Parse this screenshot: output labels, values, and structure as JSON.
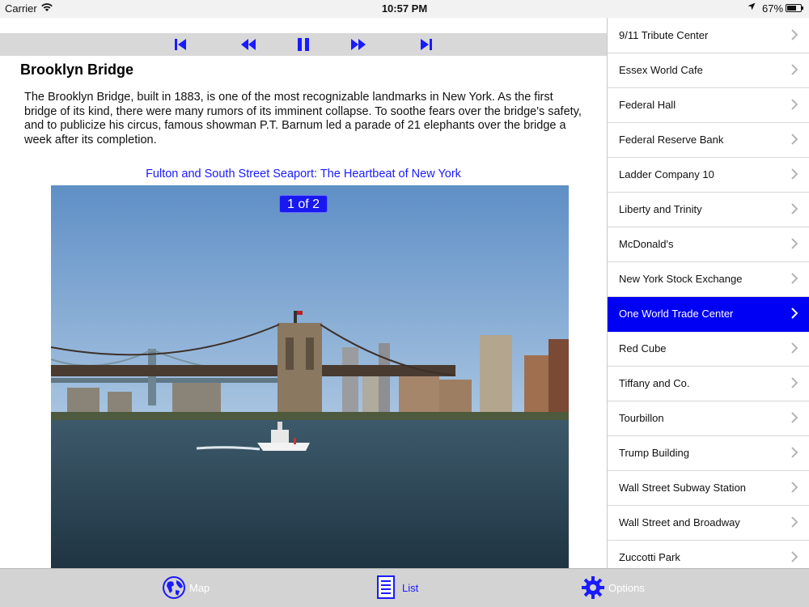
{
  "status_bar": {
    "carrier": "Carrier",
    "time": "10:57 PM",
    "battery_percent": "67%",
    "battery_level": 0.67,
    "icons": [
      "wifi-icon",
      "location-arrow-icon",
      "battery-icon"
    ]
  },
  "media_controls": {
    "icons": [
      "skip-back-icon",
      "rewind-icon",
      "pause-icon",
      "fast-forward-icon",
      "skip-forward-icon"
    ],
    "color": "#1a1aff"
  },
  "detail": {
    "title": "Brooklyn Bridge",
    "description": "The Brooklyn Bridge, built in 1883, is one of the most recognizable landmarks in New York. As the first bridge of its kind, there were many rumors of its imminent collapse. To soothe fears over the bridge's safety, and to publicize his circus, famous showman P.T. Barnum led a parade of 21 elephants over the bridge a week after its completion.",
    "caption": "Fulton and South Street Seaport: The Heartbeat of New York",
    "photo_counter": "1 of 2"
  },
  "sidebar": {
    "items": [
      {
        "label": "9/11 Tribute Center",
        "selected": false
      },
      {
        "label": "Essex World Cafe",
        "selected": false
      },
      {
        "label": "Federal Hall",
        "selected": false
      },
      {
        "label": "Federal Reserve Bank",
        "selected": false
      },
      {
        "label": "Ladder Company 10",
        "selected": false
      },
      {
        "label": "Liberty and Trinity",
        "selected": false
      },
      {
        "label": "McDonald's",
        "selected": false
      },
      {
        "label": "New York Stock Exchange",
        "selected": false
      },
      {
        "label": "One World Trade Center",
        "selected": true
      },
      {
        "label": "Red Cube",
        "selected": false
      },
      {
        "label": "Tiffany and Co.",
        "selected": false
      },
      {
        "label": "Tourbillon",
        "selected": false
      },
      {
        "label": "Trump Building",
        "selected": false
      },
      {
        "label": "Wall Street Subway Station",
        "selected": false
      },
      {
        "label": "Wall Street and Broadway",
        "selected": false
      },
      {
        "label": "Zuccotti Park",
        "selected": false
      }
    ],
    "selected_color": "#0000f5"
  },
  "tab_bar": {
    "tabs": [
      {
        "label": "Map",
        "icon": "globe-icon",
        "active": false
      },
      {
        "label": "List",
        "icon": "document-list-icon",
        "active": true
      },
      {
        "label": "Options",
        "icon": "gear-icon",
        "active": false
      }
    ],
    "active_color": "#1a1aff",
    "inactive_label_color": "#ffffff"
  }
}
